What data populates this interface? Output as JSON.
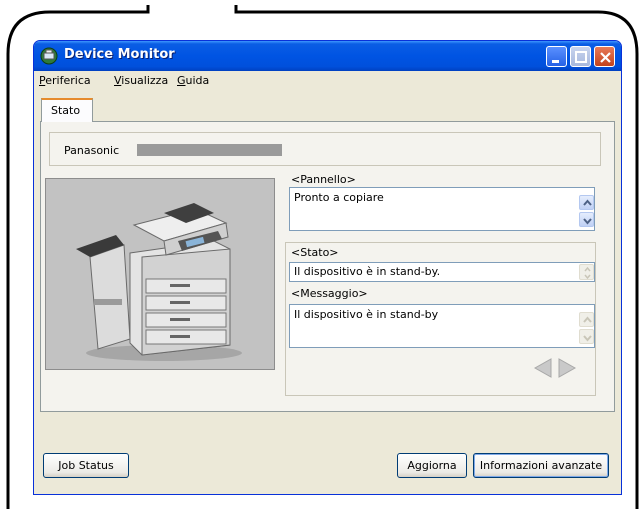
{
  "window": {
    "title": "Device Monitor"
  },
  "menu": {
    "items": [
      "Periferica",
      "Visualizza",
      "Guida"
    ]
  },
  "tabs": [
    {
      "label": "Stato",
      "selected": true
    }
  ],
  "device": {
    "name": "Panasonic"
  },
  "panels": {
    "pannello": {
      "label": "<Pannello>",
      "value": "Pronto a copiare"
    },
    "stato": {
      "label": "<Stato>",
      "value": "Il dispositivo è in stand-by."
    },
    "messaggio": {
      "label": "<Messaggio>",
      "value": "Il dispositivo è in stand-by"
    }
  },
  "buttons": {
    "job_status": "Job Status",
    "aggiorna": "Aggiorna",
    "informazioni": "Informazioni avanzate"
  },
  "colors": {
    "titlebar": "#0054e3",
    "window_bg": "#ece9d8",
    "tab_accent": "#e68b2c"
  }
}
